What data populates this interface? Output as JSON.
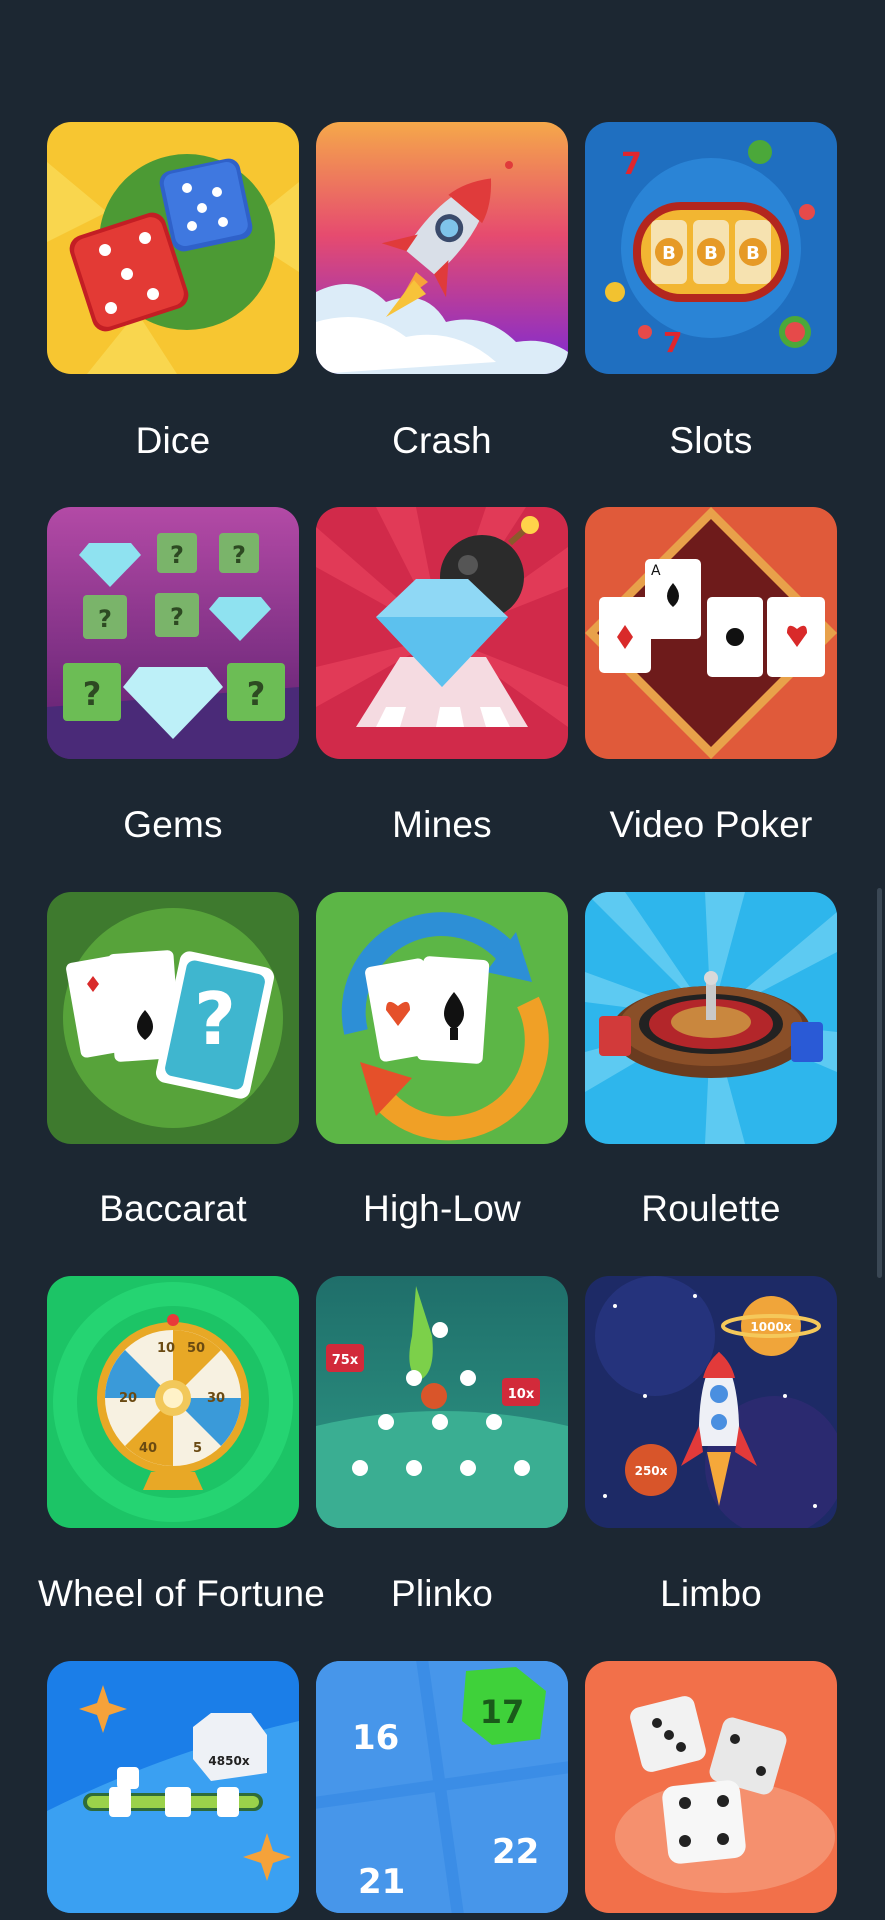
{
  "games": [
    {
      "label": "Dice"
    },
    {
      "label": "Crash"
    },
    {
      "label": "Slots"
    },
    {
      "label": "Gems"
    },
    {
      "label": "Mines"
    },
    {
      "label": "Video Poker"
    },
    {
      "label": "Baccarat"
    },
    {
      "label": "High-Low"
    },
    {
      "label": "Roulette"
    },
    {
      "label": "Wheel of Fortune"
    },
    {
      "label": "Plinko"
    },
    {
      "label": "Limbo"
    },
    {
      "label": ""
    },
    {
      "label": ""
    },
    {
      "label": ""
    }
  ],
  "tile_text": {
    "plinko_left": "75x",
    "plinko_right": "10x",
    "limbo_top": "1000x",
    "limbo_bottom": "250x",
    "slider_value": "4850x",
    "keno_a": "16",
    "keno_b": "17",
    "keno_c": "21",
    "keno_d": "22",
    "wheel_a": "10",
    "wheel_b": "50",
    "wheel_c": "20",
    "wheel_d": "30",
    "wheel_e": "40",
    "wheel_f": "5"
  }
}
